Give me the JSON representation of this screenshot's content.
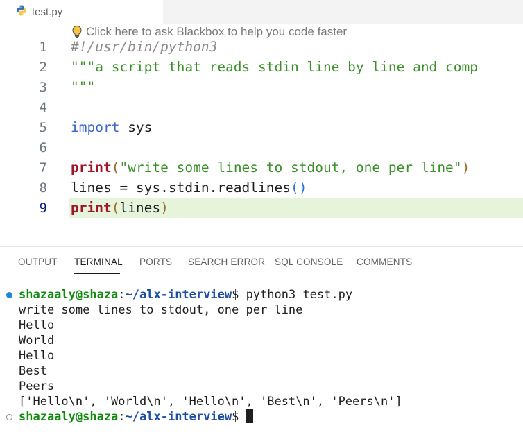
{
  "tab": {
    "filename": "test.py",
    "icon": "python-icon"
  },
  "editor": {
    "hint": "Click here to ask Blackbox to help you code faster",
    "lines": [
      {
        "n": "1",
        "segments": [
          {
            "cls": "c-comment",
            "t": "#!/usr/bin/python3"
          }
        ]
      },
      {
        "n": "2",
        "segments": [
          {
            "cls": "c-string",
            "t": "\"\"\"a script that reads stdin line by line and comp"
          }
        ]
      },
      {
        "n": "3",
        "segments": [
          {
            "cls": "c-string",
            "t": "\"\"\""
          }
        ]
      },
      {
        "n": "4",
        "segments": []
      },
      {
        "n": "5",
        "segments": [
          {
            "cls": "c-kw",
            "t": "import"
          },
          {
            "cls": "",
            "t": " sys"
          }
        ]
      },
      {
        "n": "6",
        "segments": []
      },
      {
        "n": "7",
        "segments": [
          {
            "cls": "c-fn",
            "t": "print"
          },
          {
            "cls": "c-paren",
            "t": "("
          },
          {
            "cls": "c-string",
            "t": "\"write some lines to stdout, one per line\""
          },
          {
            "cls": "c-paren",
            "t": ")"
          }
        ]
      },
      {
        "n": "8",
        "segments": [
          {
            "cls": "",
            "t": "lines = sys.stdin.readlines"
          },
          {
            "cls": "c-paren2",
            "t": "()"
          }
        ]
      },
      {
        "n": "9",
        "segments": [
          {
            "cls": "c-fn",
            "t": "print"
          },
          {
            "cls": "c-paren",
            "t": "("
          },
          {
            "cls": "",
            "t": "lines"
          },
          {
            "cls": "c-paren",
            "t": ")"
          }
        ],
        "active": true
      }
    ]
  },
  "panel": {
    "tabs": [
      "OUTPUT",
      "TERMINAL",
      "PORTS",
      "SEARCH ERROR",
      "SQL CONSOLE",
      "COMMENTS"
    ],
    "active_tab": "TERMINAL"
  },
  "terminal": {
    "prompt_user": "shazaaly@shaza",
    "prompt_sep": ":",
    "prompt_path": "~/alx-interview",
    "prompt_end": "$",
    "command": " python3 test.py",
    "output": [
      "write some lines to stdout, one per line",
      "Hello",
      "World",
      "Hello",
      "Best",
      "Peers",
      "['Hello\\n', 'World\\n', 'Hello\\n', 'Best\\n', 'Peers\\n']"
    ]
  },
  "colors": {
    "prompt_user": "#128a12",
    "prompt_path": "#1f4ea0",
    "active_line": "#e6f4dc",
    "status_dot": "#1f86d6"
  }
}
